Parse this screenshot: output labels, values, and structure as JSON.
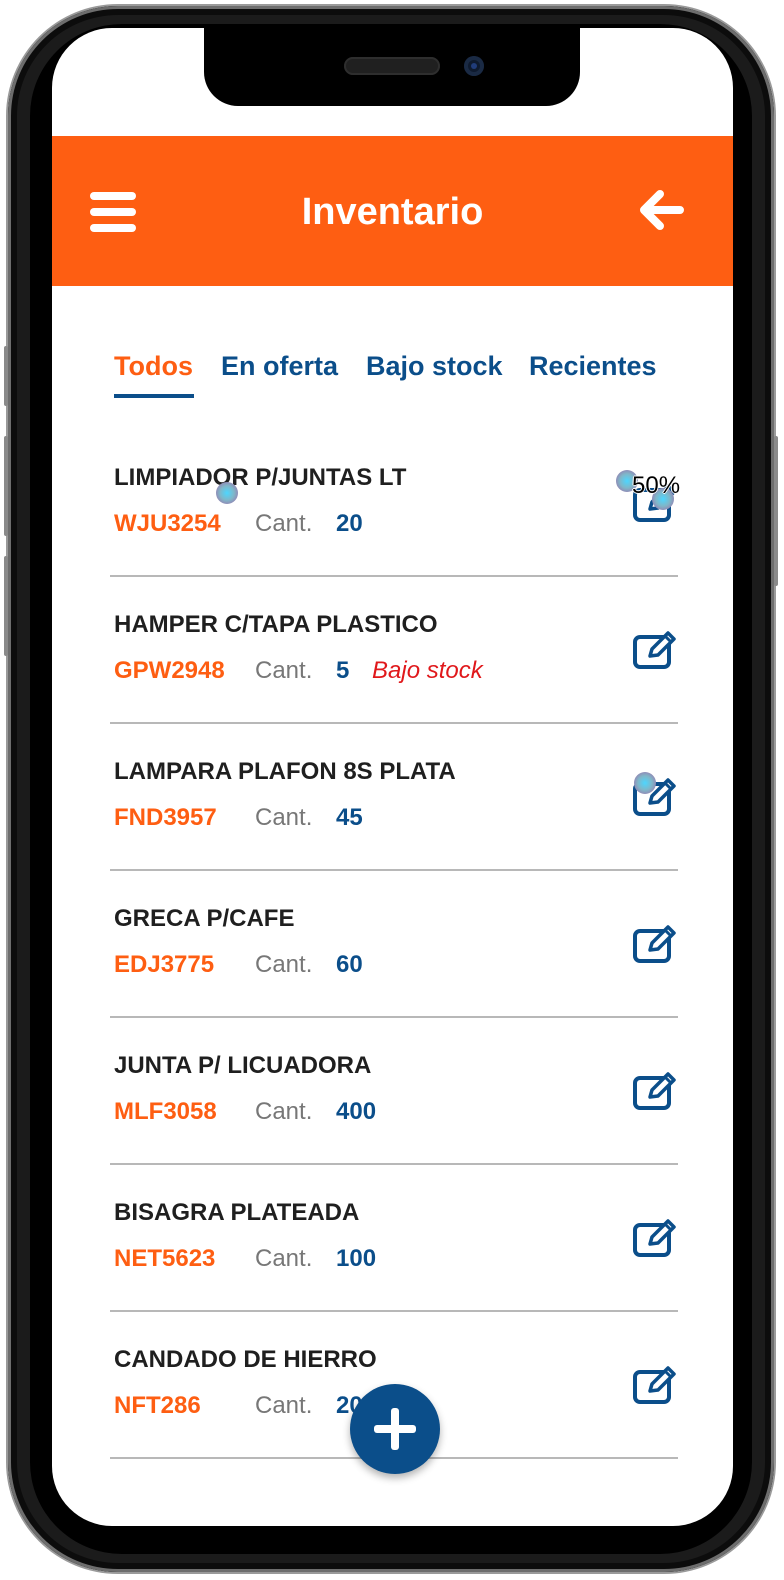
{
  "app": {
    "title": "Inventario",
    "colors": {
      "accent": "#fe5e12",
      "primary": "#0b4e8a",
      "warning": "#e0181b"
    }
  },
  "header": {
    "menu_icon": "hamburger-menu-icon",
    "back_icon": "arrow-left-icon"
  },
  "tabs": [
    {
      "label": "Todos",
      "active": true
    },
    {
      "label": "En oferta",
      "active": false
    },
    {
      "label": "Bajo stock",
      "active": false
    },
    {
      "label": "Recientes",
      "active": false
    }
  ],
  "items": [
    {
      "name": "LIMPIADOR P/JUNTAS LT",
      "code": "WJU3254",
      "qty_label": "Cant.",
      "qty": "20",
      "badge": ""
    },
    {
      "name": "HAMPER C/TAPA PLASTICO",
      "code": "GPW2948",
      "qty_label": "Cant.",
      "qty": "5",
      "badge": "Bajo stock"
    },
    {
      "name": "LAMPARA PLAFON 8S PLATA",
      "code": "FND3957",
      "qty_label": "Cant.",
      "qty": "45",
      "badge": ""
    },
    {
      "name": "GRECA P/CAFE",
      "code": "EDJ3775",
      "qty_label": "Cant.",
      "qty": "60",
      "badge": ""
    },
    {
      "name": "JUNTA P/ LICUADORA",
      "code": "MLF3058",
      "qty_label": "Cant.",
      "qty": "400",
      "badge": ""
    },
    {
      "name": "BISAGRA PLATEADA",
      "code": "NET5623",
      "qty_label": "Cant.",
      "qty": "100",
      "badge": ""
    },
    {
      "name": "CANDADO DE HIERRO",
      "code": "NFT286",
      "qty_label": "Cant.",
      "qty": "20",
      "badge": ""
    }
  ],
  "edit_icon": "edit-icon",
  "fab": {
    "icon": "plus-icon"
  },
  "overlay": {
    "zoom_label": "50%"
  }
}
